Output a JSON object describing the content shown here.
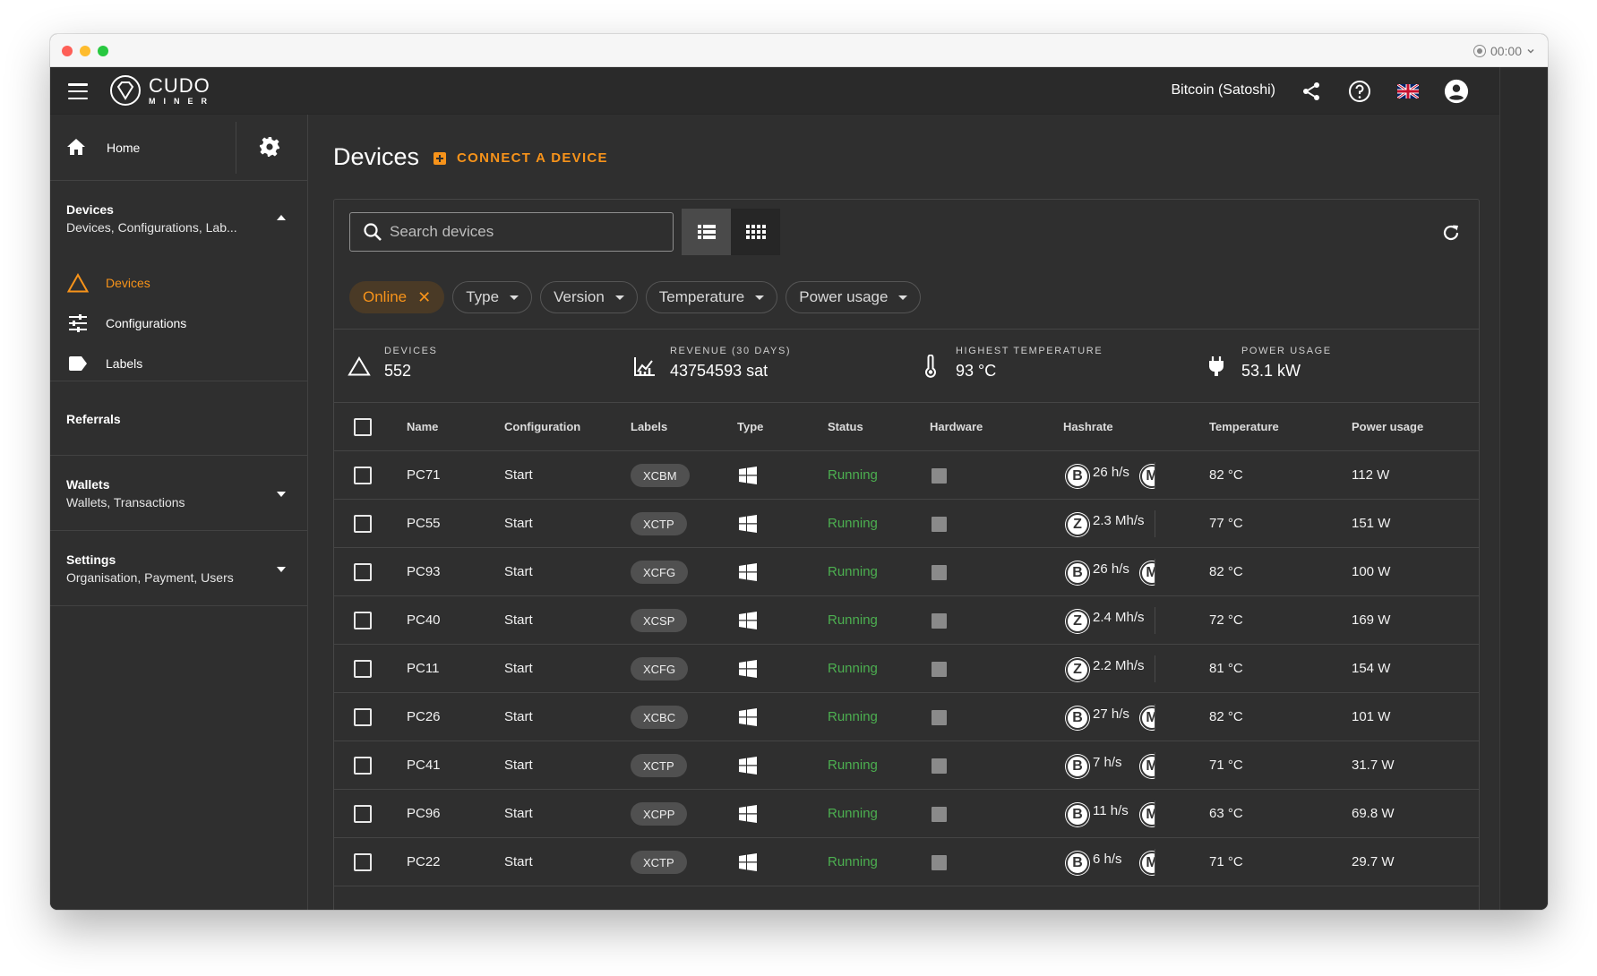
{
  "window": {
    "recording_time": "00:00"
  },
  "topbar": {
    "logo_line1": "CUDO",
    "logo_line2": "MINER",
    "currency": "Bitcoin (Satoshi)"
  },
  "sidebar": {
    "home": "Home",
    "devices": {
      "title": "Devices",
      "subtitle": "Devices, Configurations, Lab...",
      "items": [
        {
          "label": "Devices"
        },
        {
          "label": "Configurations"
        },
        {
          "label": "Labels"
        }
      ]
    },
    "referrals": "Referrals",
    "wallets": {
      "title": "Wallets",
      "subtitle": "Wallets, Transactions"
    },
    "settings": {
      "title": "Settings",
      "subtitle": "Organisation, Payment, Users"
    }
  },
  "main": {
    "title": "Devices",
    "connect_label": "CONNECT A DEVICE",
    "search_placeholder": "Search devices",
    "filters": [
      "Online",
      "Type",
      "Version",
      "Temperature",
      "Power usage"
    ],
    "stats": [
      {
        "label": "DEVICES",
        "value": "552"
      },
      {
        "label": "REVENUE (30 DAYS)",
        "value": "43754593 sat"
      },
      {
        "label": "HIGHEST TEMPERATURE",
        "value": "93 °C"
      },
      {
        "label": "POWER USAGE",
        "value": "53.1 kW"
      }
    ],
    "columns": [
      "Name",
      "Configuration",
      "Labels",
      "Type",
      "Status",
      "Hardware",
      "Hashrate",
      "Temperature",
      "Power usage"
    ],
    "rows": [
      {
        "name": "PC71",
        "config": "Start",
        "label": "XCBM",
        "status": "Running",
        "coin1": "B",
        "hashrate": "26 h/s",
        "coin2": "M",
        "temp": "82 °C",
        "power": "112 W"
      },
      {
        "name": "PC55",
        "config": "Start",
        "label": "XCTP",
        "status": "Running",
        "coin1": "Z",
        "hashrate": "2.3 Mh/s",
        "coin2": "",
        "temp": "77 °C",
        "power": "151 W"
      },
      {
        "name": "PC93",
        "config": "Start",
        "label": "XCFG",
        "status": "Running",
        "coin1": "B",
        "hashrate": "26 h/s",
        "coin2": "M",
        "temp": "82 °C",
        "power": "100 W"
      },
      {
        "name": "PC40",
        "config": "Start",
        "label": "XCSP",
        "status": "Running",
        "coin1": "Z",
        "hashrate": "2.4 Mh/s",
        "coin2": "",
        "temp": "72 °C",
        "power": "169 W"
      },
      {
        "name": "PC11",
        "config": "Start",
        "label": "XCFG",
        "status": "Running",
        "coin1": "Z",
        "hashrate": "2.2 Mh/s",
        "coin2": "",
        "temp": "81 °C",
        "power": "154 W"
      },
      {
        "name": "PC26",
        "config": "Start",
        "label": "XCBC",
        "status": "Running",
        "coin1": "B",
        "hashrate": "27 h/s",
        "coin2": "M",
        "temp": "82 °C",
        "power": "101 W"
      },
      {
        "name": "PC41",
        "config": "Start",
        "label": "XCTP",
        "status": "Running",
        "coin1": "B",
        "hashrate": "7 h/s",
        "coin2": "M",
        "temp": "71 °C",
        "power": "31.7 W"
      },
      {
        "name": "PC96",
        "config": "Start",
        "label": "XCPP",
        "status": "Running",
        "coin1": "B",
        "hashrate": "11 h/s",
        "coin2": "M",
        "temp": "63 °C",
        "power": "69.8 W"
      },
      {
        "name": "PC22",
        "config": "Start",
        "label": "XCTP",
        "status": "Running",
        "coin1": "B",
        "hashrate": "6 h/s",
        "coin2": "M",
        "temp": "71 °C",
        "power": "29.7 W"
      }
    ]
  },
  "colors": {
    "accent": "#f7931a",
    "running": "#4caf50",
    "background": "#2f2f2f"
  }
}
